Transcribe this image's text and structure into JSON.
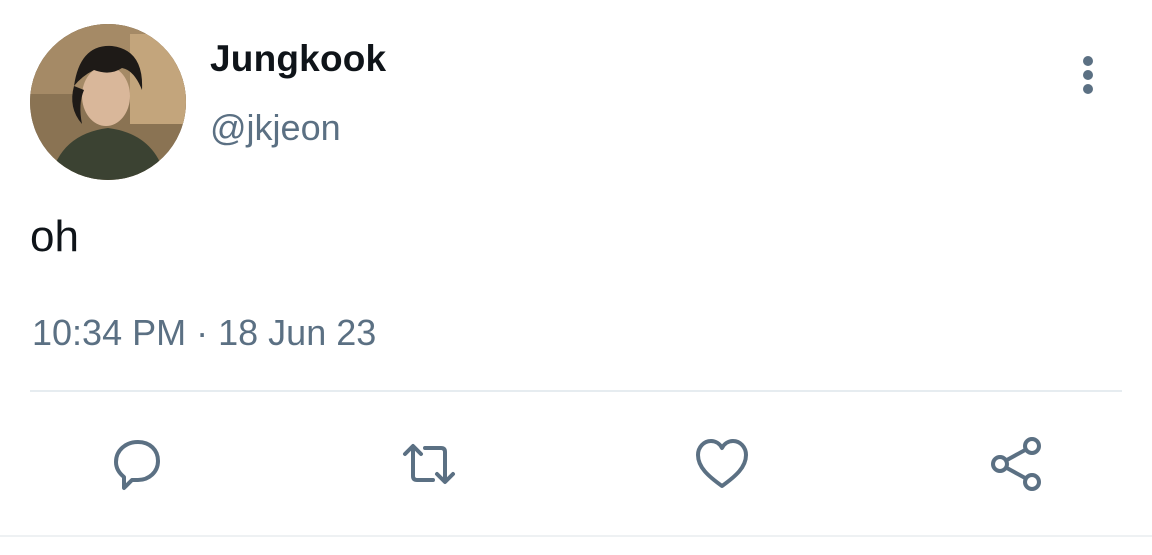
{
  "user": {
    "display_name": "Jungkook",
    "handle": "@jkjeon"
  },
  "tweet": {
    "text": "oh",
    "time": "10:34 PM",
    "separator": "·",
    "date": "18 Jun 23"
  },
  "icons": {
    "more": "more-vertical-icon",
    "reply": "reply-icon",
    "retweet": "retweet-icon",
    "like": "heart-icon",
    "share": "share-icon"
  },
  "colors": {
    "primary_text": "#0f1419",
    "secondary_text": "#5b7083",
    "icon": "#5b7083",
    "divider": "#e6ecf0"
  }
}
